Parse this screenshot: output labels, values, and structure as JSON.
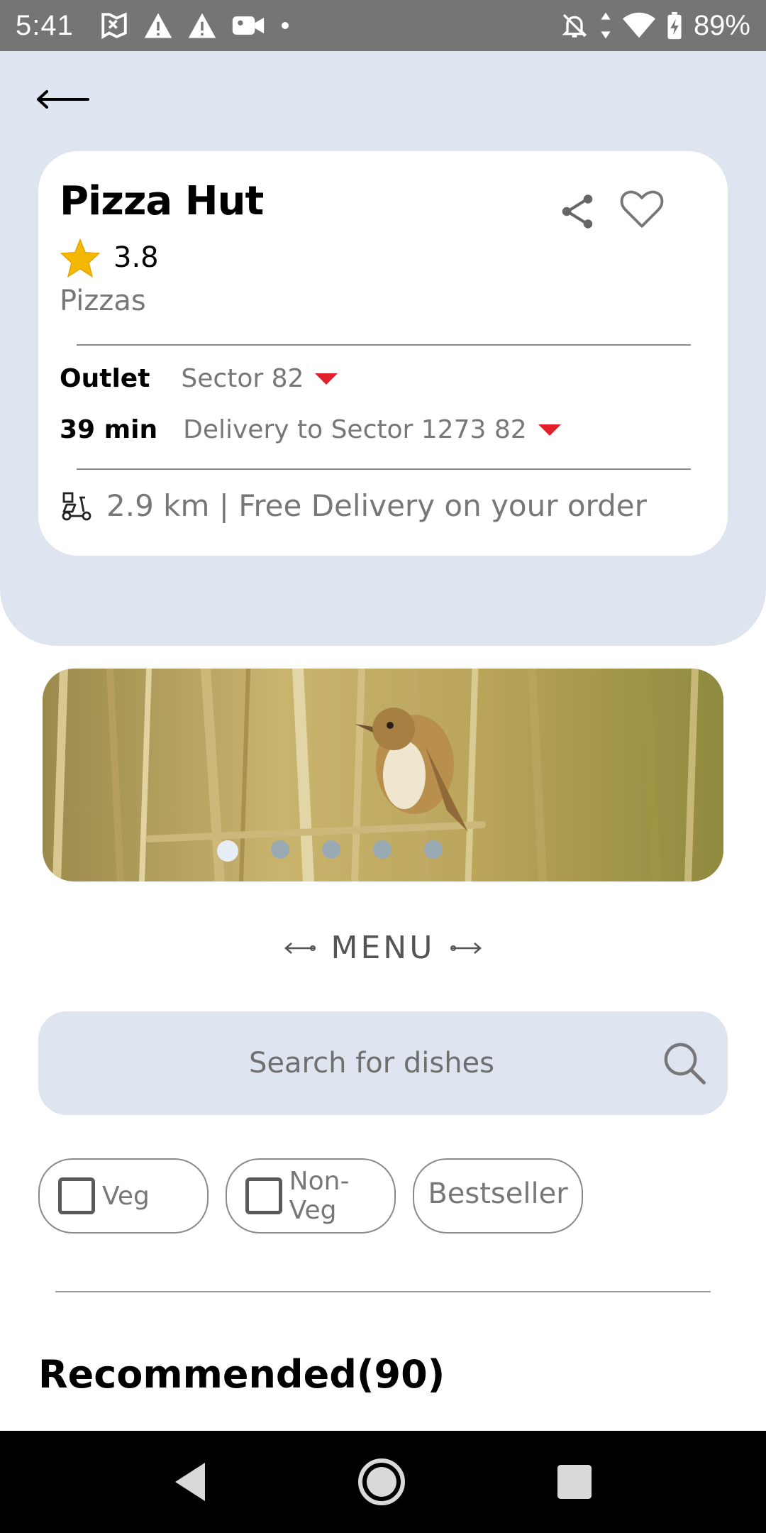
{
  "status_bar": {
    "time": "5:41",
    "battery": "89%",
    "icons_left": [
      "map-flag-icon",
      "warning-icon",
      "warning-icon",
      "video-camera-icon",
      "dot-icon"
    ],
    "icons_right": [
      "bell-off-icon",
      "data-arrows-icon",
      "wifi-icon",
      "battery-charging-icon"
    ]
  },
  "header": {
    "back_icon": "arrow-left-icon"
  },
  "restaurant": {
    "name": "Pizza Hut",
    "rating": "3.8",
    "cuisine": "Pizzas",
    "outlet_label": "Outlet",
    "outlet_value": "Sector 82",
    "time_label": "39 min",
    "delivery_value": "Delivery to Sector 1273 82",
    "distance_text": "2.9 km | Free Delivery on your order",
    "accent_color": "#e0202a",
    "star_color": "#f5b800"
  },
  "banner": {
    "slides": 5,
    "active_index": 0
  },
  "menu": {
    "label": "MENU"
  },
  "search": {
    "placeholder": "Search for dishes"
  },
  "filters": {
    "veg": "Veg",
    "non_veg": "Non-Veg",
    "bestseller": "Bestseller"
  },
  "section": {
    "recommended": "Recommended(90)"
  }
}
